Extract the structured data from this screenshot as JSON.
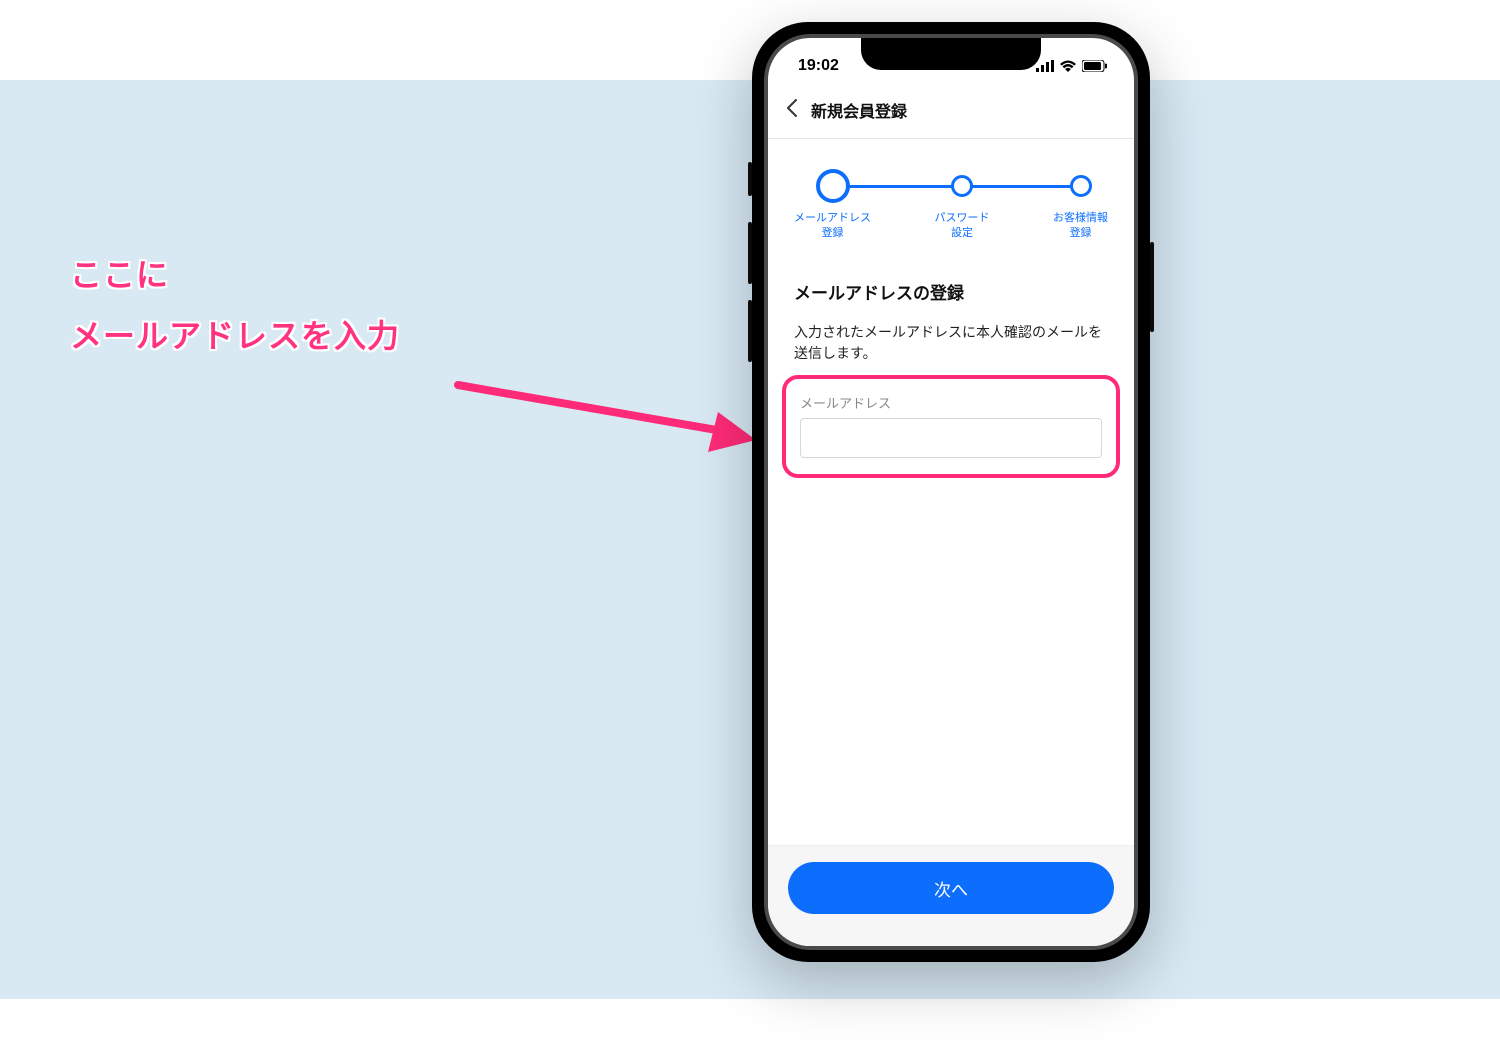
{
  "annotation": {
    "line1": "ここに",
    "line2": "メールアドレスを入力"
  },
  "status_bar": {
    "time": "19:02"
  },
  "nav": {
    "title": "新規会員登録"
  },
  "stepper": {
    "step1_line1": "メールアドレス",
    "step1_line2": "登録",
    "step2_line1": "パスワード",
    "step2_line2": "設定",
    "step3_line1": "お客様情報",
    "step3_line2": "登録"
  },
  "section": {
    "title": "メールアドレスの登録",
    "description": "入力されたメールアドレスに本人確認のメールを送信します。"
  },
  "input": {
    "label": "メールアドレス",
    "value": ""
  },
  "button": {
    "next": "次へ"
  }
}
